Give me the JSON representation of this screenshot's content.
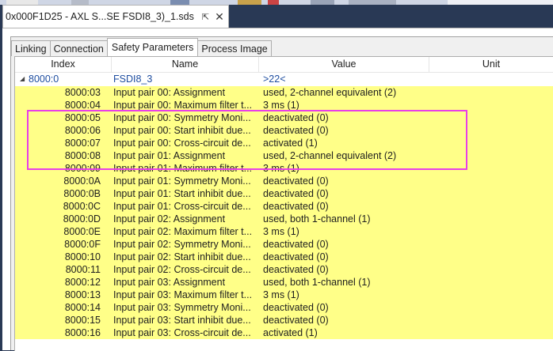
{
  "document_tab": {
    "title": "0x000F1D25 - AXL S...SE FSDI8_3)_1.sds",
    "pin_glyph": "⇱",
    "close_glyph": "✕"
  },
  "tabs": [
    {
      "label": "Linking",
      "active": false
    },
    {
      "label": "Connection",
      "active": false
    },
    {
      "label": "Safety Parameters",
      "active": true
    },
    {
      "label": "Process Image",
      "active": false
    }
  ],
  "columns": {
    "index": "Index",
    "name": "Name",
    "value": "Value",
    "unit": "Unit"
  },
  "group": {
    "expander": "◢",
    "index": "8000:0",
    "name": "FSDI8_3",
    "value": ">22<"
  },
  "rows": [
    {
      "index": "8000:03",
      "name": "Input pair 00: Assignment",
      "value": "used, 2-channel equivalent (2)"
    },
    {
      "index": "8000:04",
      "name": "Input pair 00: Maximum filter t...",
      "value": "3 ms (1)"
    },
    {
      "index": "8000:05",
      "name": "Input pair 00: Symmetry Moni...",
      "value": "deactivated (0)"
    },
    {
      "index": "8000:06",
      "name": "Input pair 00: Start inhibit due...",
      "value": "deactivated (0)"
    },
    {
      "index": "8000:07",
      "name": "Input pair 00: Cross-circuit de...",
      "value": "activated (1)"
    },
    {
      "index": "8000:08",
      "name": "Input pair 01: Assignment",
      "value": "used, 2-channel equivalent (2)"
    },
    {
      "index": "8000:09",
      "name": "Input pair 01: Maximum filter t...",
      "value": "3 ms (1)"
    },
    {
      "index": "8000:0A",
      "name": "Input pair 01: Symmetry Moni...",
      "value": "deactivated (0)"
    },
    {
      "index": "8000:0B",
      "name": "Input pair 01: Start inhibit due...",
      "value": "deactivated (0)"
    },
    {
      "index": "8000:0C",
      "name": "Input pair 01: Cross-circuit de...",
      "value": "deactivated (0)"
    },
    {
      "index": "8000:0D",
      "name": "Input pair 02: Assignment",
      "value": "used, both 1-channel (1)"
    },
    {
      "index": "8000:0E",
      "name": "Input pair 02: Maximum filter t...",
      "value": "3 ms (1)"
    },
    {
      "index": "8000:0F",
      "name": "Input pair 02: Symmetry Moni...",
      "value": "deactivated (0)"
    },
    {
      "index": "8000:10",
      "name": "Input pair 02: Start inhibit due...",
      "value": "deactivated (0)"
    },
    {
      "index": "8000:11",
      "name": "Input pair 02: Cross-circuit de...",
      "value": "deactivated (0)"
    },
    {
      "index": "8000:12",
      "name": "Input pair 03: Assignment",
      "value": "used, both 1-channel (1)"
    },
    {
      "index": "8000:13",
      "name": "Input pair 03: Maximum filter t...",
      "value": "3 ms (1)"
    },
    {
      "index": "8000:14",
      "name": "Input pair 03: Symmetry Moni...",
      "value": "deactivated (0)"
    },
    {
      "index": "8000:15",
      "name": "Input pair 03: Start inhibit due...",
      "value": "deactivated (0)"
    },
    {
      "index": "8000:16",
      "name": "Input pair 03: Cross-circuit de...",
      "value": "activated (1)"
    }
  ],
  "colors": {
    "row_highlight": "#ffff88",
    "selection_outline": "#e83fe8",
    "group_text": "#1f4ea0"
  }
}
